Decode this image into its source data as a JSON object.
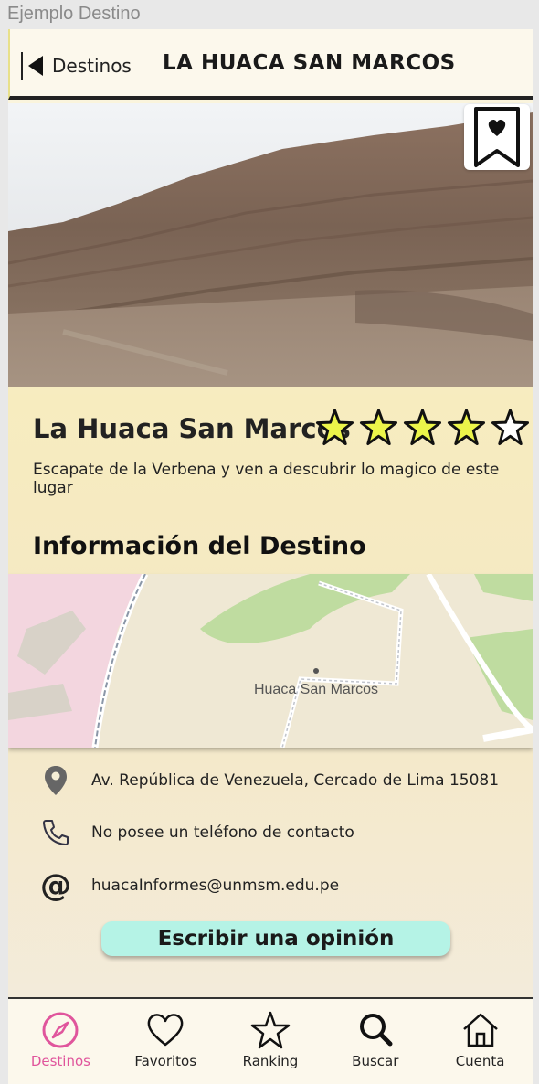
{
  "frame": {
    "label": "Ejemplo Destino"
  },
  "header": {
    "back_label": "Destinos",
    "title": "LA HUACA SAN MARCOS"
  },
  "hero": {
    "image": "huaca-pyramid-photo",
    "bookmark_icon": "bookmark-heart-icon"
  },
  "place": {
    "name": "La Huaca San Marcos",
    "rating": 4,
    "rating_max": 5,
    "description": "Escapate de la Verbena y ven a descubrir lo magico de este lugar"
  },
  "info": {
    "section_title": "Información del Destino",
    "map_label": "Huaca San Marcos",
    "address": "Av. República de Venezuela, Cercado de Lima 15081",
    "phone": "No posee un teléfono de contacto",
    "email": "huacaInformes@unmsm.edu.pe"
  },
  "actions": {
    "write_review": "Escribir una opinión"
  },
  "tabs": [
    {
      "label": "Destinos",
      "icon": "compass-icon",
      "active": true
    },
    {
      "label": "Favoritos",
      "icon": "heart-icon",
      "active": false
    },
    {
      "label": "Ranking",
      "icon": "star-icon",
      "active": false
    },
    {
      "label": "Buscar",
      "icon": "search-icon",
      "active": false
    },
    {
      "label": "Cuenta",
      "icon": "home-icon",
      "active": false
    }
  ],
  "colors": {
    "accent": "#e0559c",
    "star_fill": "#ecf54a",
    "button": "#b5f3e6"
  }
}
